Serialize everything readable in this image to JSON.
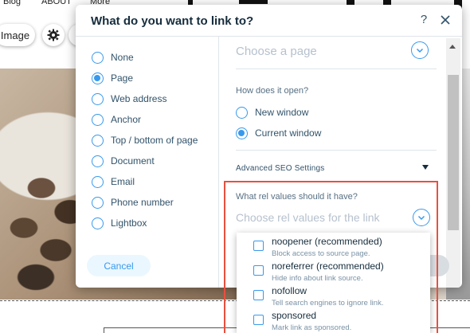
{
  "background": {
    "nav_items": [
      "Blog",
      "ABOUT",
      "More"
    ],
    "toolbar": {
      "image_button_label": "Image"
    }
  },
  "dialog": {
    "title": "What do you want to link to?",
    "help_glyph": "?",
    "close_glyph": "✕",
    "link_types": [
      {
        "label": "None",
        "selected": false
      },
      {
        "label": "Page",
        "selected": true
      },
      {
        "label": "Web address",
        "selected": false
      },
      {
        "label": "Anchor",
        "selected": false
      },
      {
        "label": "Top / bottom of page",
        "selected": false
      },
      {
        "label": "Document",
        "selected": false
      },
      {
        "label": "Email",
        "selected": false
      },
      {
        "label": "Phone number",
        "selected": false
      },
      {
        "label": "Lightbox",
        "selected": false
      }
    ],
    "page_select_placeholder": "Choose a page",
    "open_question": "How does it open?",
    "open_options": [
      {
        "label": "New window",
        "selected": false
      },
      {
        "label": "Current window",
        "selected": true
      }
    ],
    "advanced_seo_label": "Advanced SEO Settings",
    "rel_question": "What rel values should it have?",
    "rel_placeholder": "Choose rel values for the link",
    "rel_options": [
      {
        "title": "noopener (recommended)",
        "description": "Block access to source page."
      },
      {
        "title": "noreferrer (recommended)",
        "description": "Hide info about link source."
      },
      {
        "title": "nofollow",
        "description": "Tell search engines to ignore link."
      },
      {
        "title": "sponsored",
        "description": "Mark link as sponsored."
      }
    ],
    "cancel_label": "Cancel"
  },
  "colors": {
    "accent": "#3899ec",
    "highlight_border": "#e8503f",
    "title_text": "#162d3d",
    "placeholder_text": "#b6c1cd"
  }
}
